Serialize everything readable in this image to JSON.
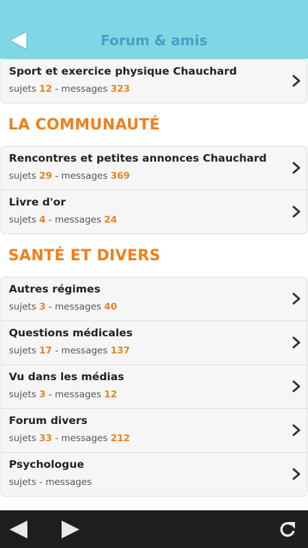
{
  "header": {
    "title": "Forum & amis"
  },
  "first_card": [
    {
      "title": "Sport et exercice physique Chauchard",
      "subjects": "12",
      "messages": "323"
    }
  ],
  "sections": [
    {
      "title": "LA COMMUNAUTÉ",
      "items": [
        {
          "title": "Rencontres et petites annonces Chauchard",
          "subjects": "29",
          "messages": "369"
        },
        {
          "title": "Livre d'or",
          "subjects": "4",
          "messages": "24"
        }
      ]
    },
    {
      "title": "SANTÉ ET DIVERS",
      "items": [
        {
          "title": "Autres régimes",
          "subjects": "3",
          "messages": "40"
        },
        {
          "title": "Questions médicales",
          "subjects": "17",
          "messages": "137"
        },
        {
          "title": "Vu dans les médias",
          "subjects": "3",
          "messages": "12"
        },
        {
          "title": "Forum divers",
          "subjects": "33",
          "messages": "212"
        },
        {
          "title": "Psychologue",
          "subjects": "",
          "messages": ""
        }
      ]
    }
  ],
  "labels": {
    "subjects": "sujets",
    "separator": "-",
    "messages": "messages"
  },
  "colors": {
    "header_bg": "#80d6e4",
    "accent": "#ef7f1a",
    "title_blue": "#4a9ec4"
  },
  "icons": {
    "header_back": "back-arrow-icon",
    "chevron": "chevron-right-icon",
    "nav_back": "nav-back-icon",
    "nav_forward": "nav-forward-icon",
    "refresh": "refresh-icon"
  }
}
